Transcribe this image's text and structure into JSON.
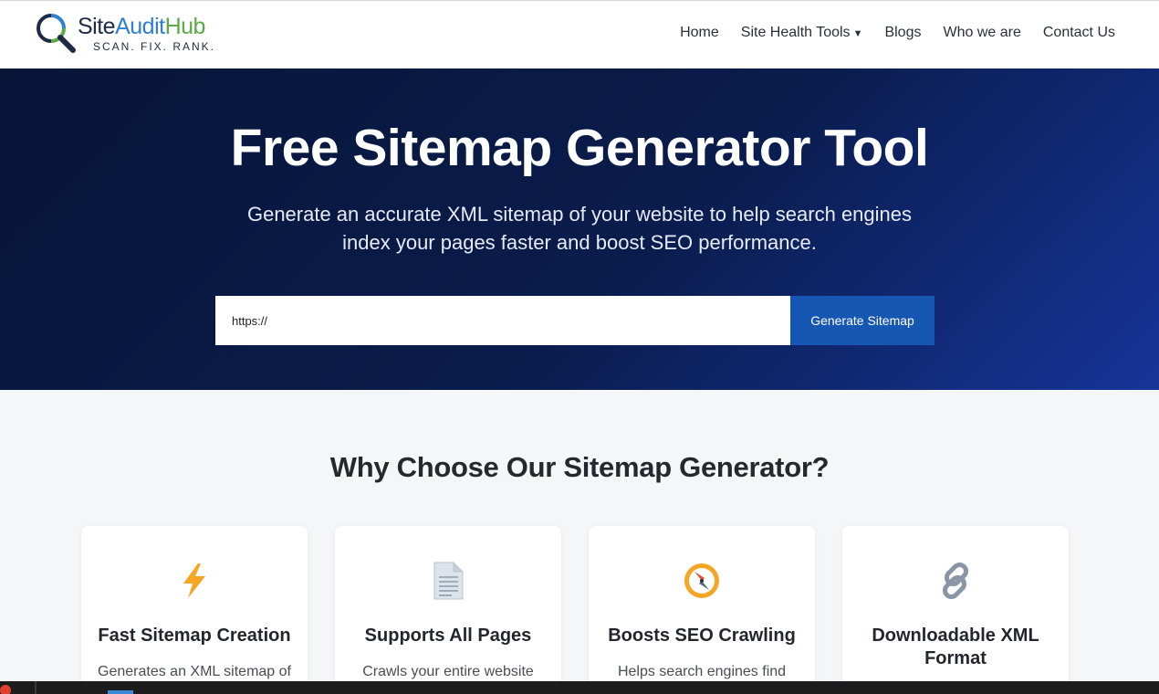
{
  "brand": {
    "name_site": "Site",
    "name_audit": "Audit",
    "name_hub": "Hub",
    "tagline": "SCAN.  FIX.  RANK."
  },
  "nav": {
    "items": [
      {
        "label": "Home"
      },
      {
        "label": "Site Health Tools",
        "caret": "▼"
      },
      {
        "label": "Blogs"
      },
      {
        "label": "Who we are"
      },
      {
        "label": "Contact Us"
      }
    ]
  },
  "hero": {
    "title": "Free Sitemap Generator Tool",
    "subtitle_line1": "Generate an accurate XML sitemap of your website to help search engines",
    "subtitle_line2": "index your pages faster and boost SEO performance.",
    "input_value": "https://",
    "button_label": "Generate Sitemap"
  },
  "features": {
    "heading": "Why Choose Our Sitemap Generator?",
    "cards": [
      {
        "icon": "lightning-icon",
        "title": "Fast Sitemap Creation",
        "desc": "Generates an XML sitemap of"
      },
      {
        "icon": "document-icon",
        "title": "Supports All Pages",
        "desc": "Crawls your entire website"
      },
      {
        "icon": "compass-icon",
        "title": "Boosts SEO Crawling",
        "desc": "Helps search engines find"
      },
      {
        "icon": "link-icon",
        "title": "Downloadable XML Format",
        "desc": ""
      }
    ]
  },
  "colors": {
    "hero_dark": "#071537",
    "hero_light": "#163498",
    "button": "#1657b3",
    "logo_blue": "#2f7fd0",
    "logo_green": "#5aac45",
    "icon_orange": "#f5a623"
  }
}
